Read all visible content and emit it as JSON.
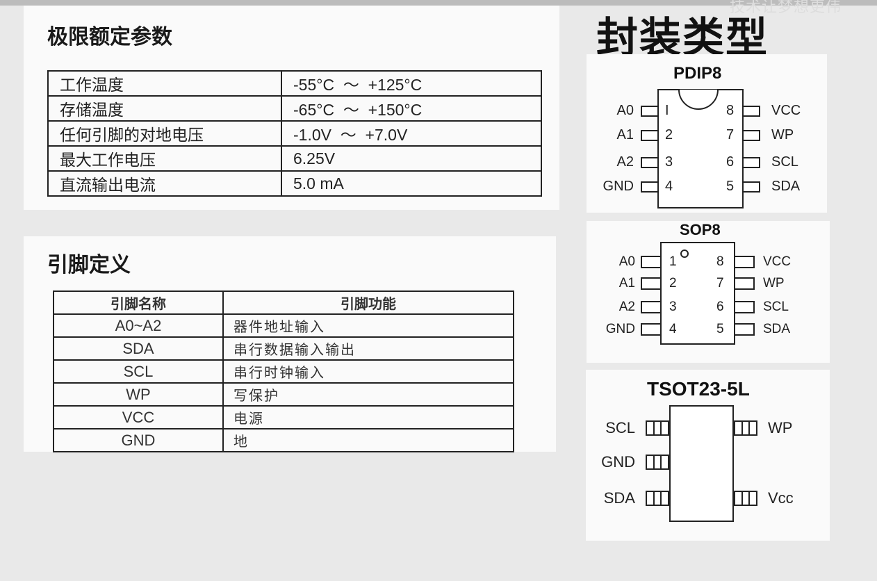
{
  "watermark": "技术让梦想更伟",
  "limits": {
    "title": "极限额定参数",
    "rows": [
      {
        "param": "工作温度",
        "value": "-55°C  ～  +125°C"
      },
      {
        "param": "存储温度",
        "value": "-65°C  ～  +150°C"
      },
      {
        "param": "任何引脚的对地电压",
        "value": "-1.0V  ～  +7.0V"
      },
      {
        "param": "最大工作电压",
        "value": "6.25V"
      },
      {
        "param": "直流输出电流",
        "value": "5.0 mA"
      }
    ]
  },
  "pins": {
    "title": "引脚定义",
    "headers": [
      "引脚名称",
      "引脚功能"
    ],
    "rows": [
      {
        "name": "A0~A2",
        "func": "器件地址输入"
      },
      {
        "name": "SDA",
        "func": "串行数据输入输出"
      },
      {
        "name": "SCL",
        "func": "串行时钟输入"
      },
      {
        "name": "WP",
        "func": "写保护"
      },
      {
        "name": "VCC",
        "func": "电源"
      },
      {
        "name": "GND",
        "func": "地"
      }
    ]
  },
  "packages": {
    "title": "封装类型",
    "pdip8": {
      "title": "PDIP8",
      "left": [
        {
          "label": "A0",
          "num": "I"
        },
        {
          "label": "A1",
          "num": "2"
        },
        {
          "label": "A2",
          "num": "3"
        },
        {
          "label": "GND",
          "num": "4"
        }
      ],
      "right": [
        {
          "label": "VCC",
          "num": "8"
        },
        {
          "label": "WP",
          "num": "7"
        },
        {
          "label": "SCL",
          "num": "6"
        },
        {
          "label": "SDA",
          "num": "5"
        }
      ]
    },
    "sop8": {
      "title": "SOP8",
      "left": [
        {
          "label": "A0",
          "num": "1"
        },
        {
          "label": "A1",
          "num": "2"
        },
        {
          "label": "A2",
          "num": "3"
        },
        {
          "label": "GND",
          "num": "4"
        }
      ],
      "right": [
        {
          "label": "VCC",
          "num": "8"
        },
        {
          "label": "WP",
          "num": "7"
        },
        {
          "label": "SCL",
          "num": "6"
        },
        {
          "label": "SDA",
          "num": "5"
        }
      ]
    },
    "tsot": {
      "title": "TSOT23-5L",
      "left": [
        "SCL",
        "GND",
        "SDA"
      ],
      "right": [
        "WP",
        "Vcc"
      ]
    }
  }
}
